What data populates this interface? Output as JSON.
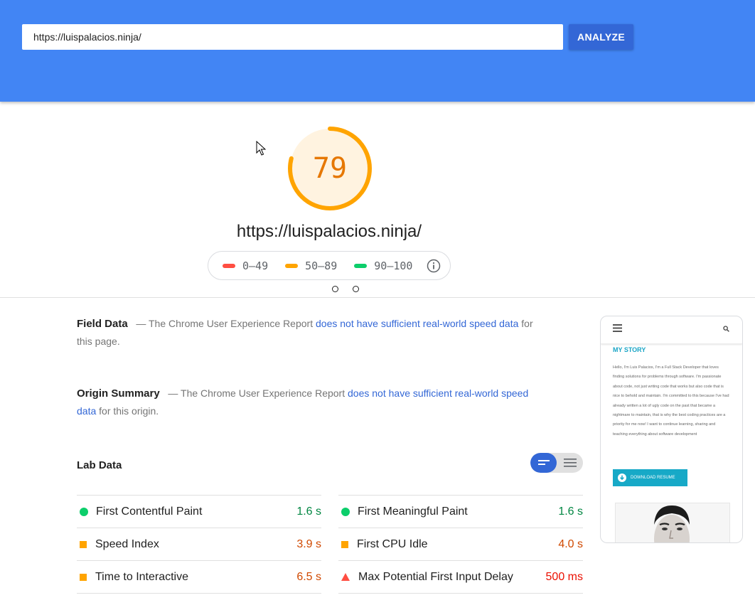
{
  "search": {
    "url_value": "https://luispalacios.ninja/",
    "analyze_label": "ANALYZE"
  },
  "score": {
    "value": "79",
    "fraction": 0.79,
    "color": "#ffa400"
  },
  "page_url": "https://luispalacios.ninja/",
  "legend": {
    "items": [
      {
        "label": "0–49",
        "color": "#ff4e42"
      },
      {
        "label": "50–89",
        "color": "#ffa400"
      },
      {
        "label": "90–100",
        "color": "#0cce6b"
      }
    ]
  },
  "field_data": {
    "title": "Field Data",
    "dash": "—",
    "text_before": "The Chrome User Experience Report",
    "link": "does not have sufficient real-world speed data",
    "text_after": "for this page."
  },
  "origin_summary": {
    "title": "Origin Summary",
    "dash": "—",
    "text_before": "The Chrome User Experience Report",
    "link": "does not have sufficient real-world speed data",
    "text_after": "for this origin."
  },
  "lab_data": {
    "title": "Lab Data",
    "metrics_left": [
      {
        "label": "First Contentful Paint",
        "value": "1.6 s",
        "status": "pass"
      },
      {
        "label": "Speed Index",
        "value": "3.9 s",
        "status": "average"
      },
      {
        "label": "Time to Interactive",
        "value": "6.5 s",
        "status": "average"
      }
    ],
    "metrics_right": [
      {
        "label": "First Meaningful Paint",
        "value": "1.6 s",
        "status": "pass"
      },
      {
        "label": "First CPU Idle",
        "value": "4.0 s",
        "status": "average"
      },
      {
        "label": "Max Potential First Input Delay",
        "value": "500 ms",
        "status": "fail"
      }
    ]
  },
  "screenshot": {
    "heading": "MY STORY",
    "paragraph": "Hello, I'm Luis Palacios, I'm a Full Stack Developer that loves finding solutions for problems through software. I'm passionate about code, not just writing code that works but also code that is nice to behold and maintain. I'm committed to this because I've had already written a lot of ugly code on the past that became a nightmare to maintain, that is why the best coding practices are a priority for me now! I want to continue learning, sharing and teaching everything about software development",
    "button_label": "DOWNLOAD RESUME"
  }
}
